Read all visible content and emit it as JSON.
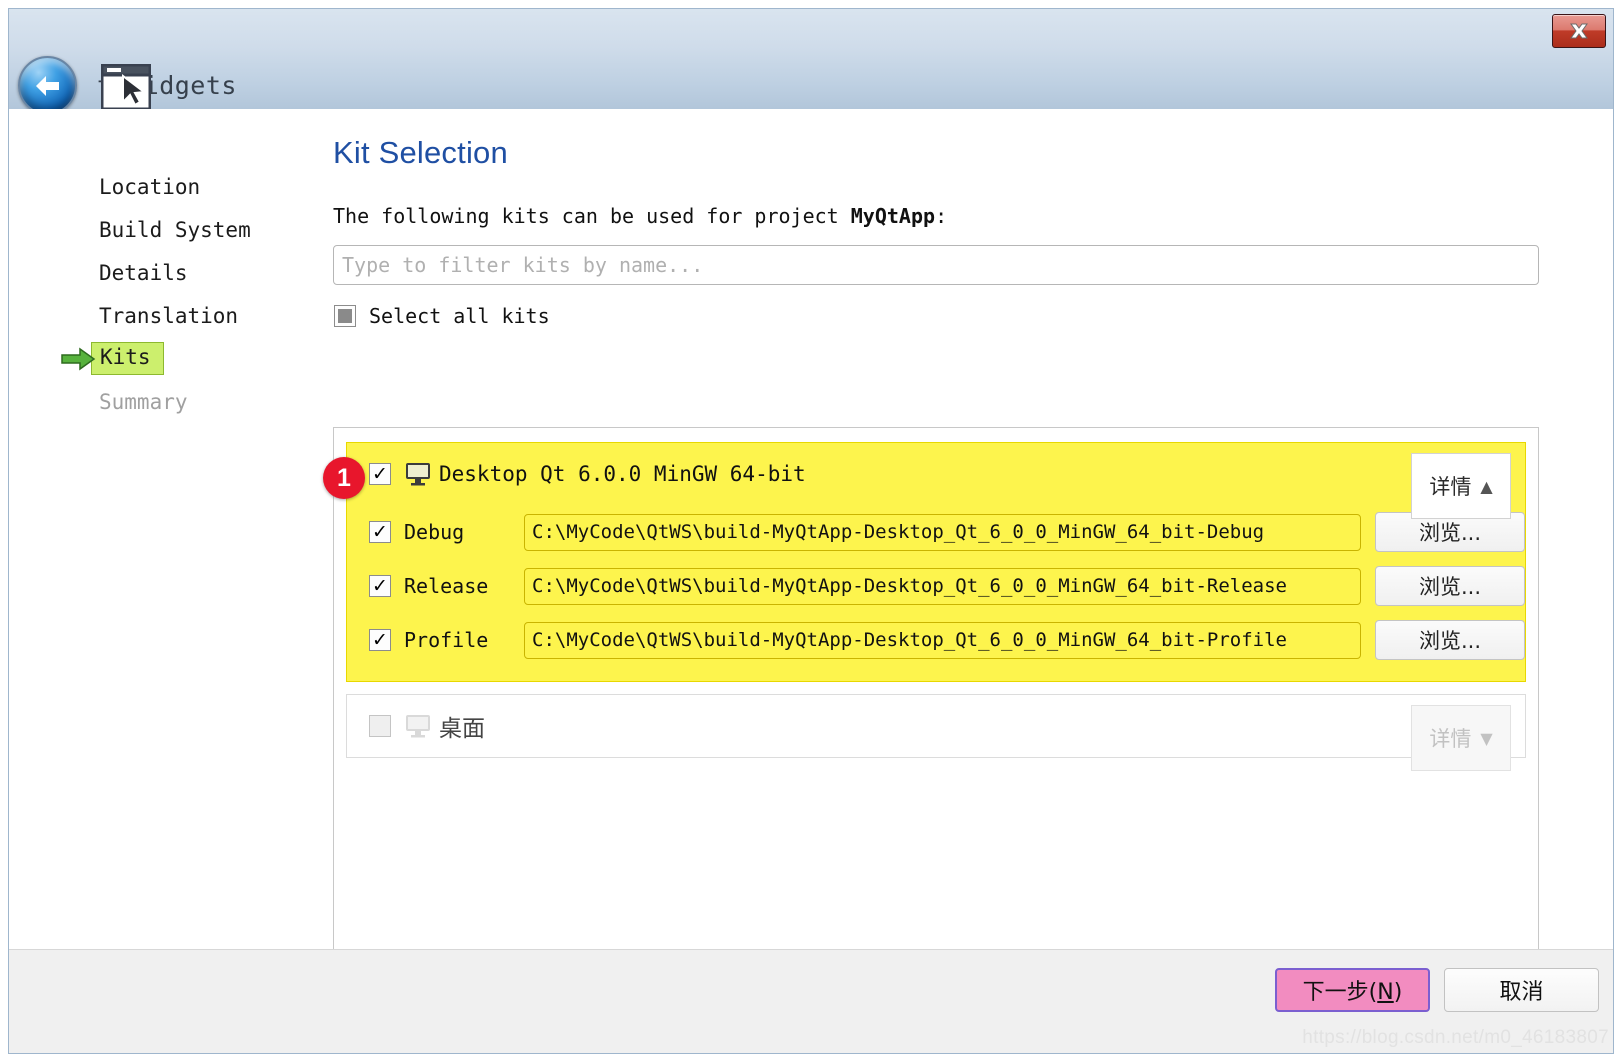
{
  "window": {
    "title": "Qt Widgets",
    "title_visible_fragment": "t Widgets",
    "back_icon": "back-arrow-icon",
    "app_icon": "window-cursor-icon",
    "close_icon": "close-x-icon"
  },
  "sidebar": {
    "items": [
      {
        "label": "Location",
        "state": "done"
      },
      {
        "label": "Build System",
        "state": "done"
      },
      {
        "label": "Details",
        "state": "done"
      },
      {
        "label": "Translation",
        "state": "done"
      },
      {
        "label": "Kits",
        "state": "current"
      },
      {
        "label": "Summary",
        "state": "disabled"
      }
    ],
    "current_arrow_icon": "green-right-arrow-icon"
  },
  "main": {
    "page_title": "Kit Selection",
    "intro_prefix": "The following kits can be used for project ",
    "intro_project": "MyQtApp",
    "intro_suffix": ":",
    "filter": {
      "value": "",
      "placeholder": "Type to filter kits by name..."
    },
    "select_all": {
      "label": "Select all kits",
      "state": "partial"
    }
  },
  "kits": [
    {
      "name": "Desktop Qt 6.0.0 MinGW 64-bit",
      "checked": true,
      "highlighted": true,
      "icon": "monitor-icon",
      "details_button": {
        "label": "详情",
        "arrow": "▲",
        "expanded": true
      },
      "annotation_badge": "1",
      "configs": [
        {
          "label": "Debug",
          "checked": true,
          "path": "C:\\MyCode\\QtWS\\build-MyQtApp-Desktop_Qt_6_0_0_MinGW_64_bit-Debug",
          "browse_label": "浏览..."
        },
        {
          "label": "Release",
          "checked": true,
          "path": "C:\\MyCode\\QtWS\\build-MyQtApp-Desktop_Qt_6_0_0_MinGW_64_bit-Release",
          "browse_label": "浏览..."
        },
        {
          "label": "Profile",
          "checked": true,
          "path": "C:\\MyCode\\QtWS\\build-MyQtApp-Desktop_Qt_6_0_0_MinGW_64_bit-Profile",
          "browse_label": "浏览..."
        }
      ]
    },
    {
      "name": "桌面",
      "checked": false,
      "highlighted": false,
      "icon": "monitor-icon",
      "details_button": {
        "label": "详情",
        "arrow": "▼",
        "expanded": false
      },
      "configs": []
    }
  ],
  "footer": {
    "next_label_prefix": "下一步(",
    "next_accel": "N",
    "next_label_suffix": ")",
    "cancel_label": "取消"
  },
  "watermark": "https://blog.csdn.net/m0_46183807",
  "colors": {
    "title_bar": "#cfdcea",
    "accent_blue": "#1f4fa3",
    "highlight_yellow": "#fdf44d",
    "nav_current_green": "#ccef6d",
    "badge_red": "#e8162c",
    "primary_button_pink": "#f28cc0",
    "close_red": "#bf3b28"
  }
}
